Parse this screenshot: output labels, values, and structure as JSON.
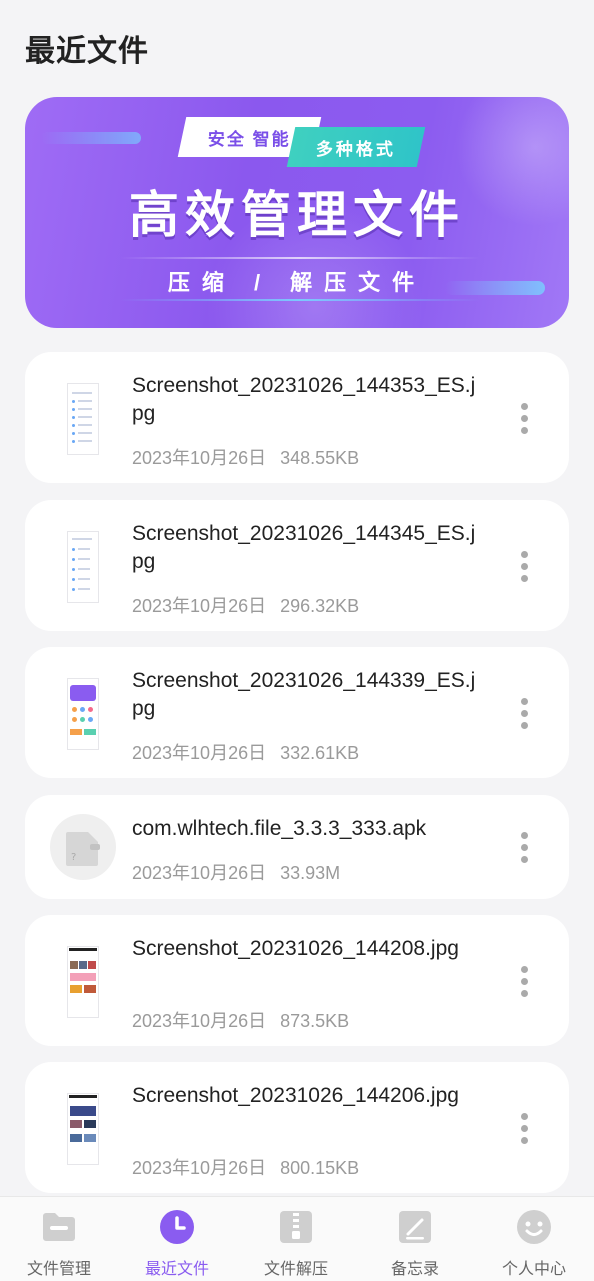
{
  "page": {
    "title": "最近文件"
  },
  "banner": {
    "tag1": "安全 智能",
    "tag2": "多种格式",
    "headline": "高效管理文件",
    "subline": "压缩 / 解压文件"
  },
  "files": [
    {
      "name": "Screenshot_20231026_144353_ES.jpg",
      "date": "2023年10月26日",
      "size": "348.55KB",
      "icon": "screenshot-thumbnail"
    },
    {
      "name": "Screenshot_20231026_144345_ES.jpg",
      "date": "2023年10月26日",
      "size": "296.32KB",
      "icon": "screenshot-thumbnail"
    },
    {
      "name": "Screenshot_20231026_144339_ES.jpg",
      "date": "2023年10月26日",
      "size": "332.61KB",
      "icon": "screenshot-thumbnail"
    },
    {
      "name": "com.wlhtech.file_3.3.3_333.apk",
      "date": "2023年10月26日",
      "size": "33.93M",
      "icon": "unknown-file-icon"
    },
    {
      "name": "Screenshot_20231026_144208.jpg",
      "date": "2023年10月26日",
      "size": "873.5KB",
      "icon": "screenshot-thumbnail"
    },
    {
      "name": "Screenshot_20231026_144206.jpg",
      "date": "2023年10月26日",
      "size": "800.15KB",
      "icon": "screenshot-thumbnail"
    }
  ],
  "nav": [
    {
      "label": "文件管理",
      "icon": "folder-icon"
    },
    {
      "label": "最近文件",
      "icon": "clock-icon",
      "active": true
    },
    {
      "label": "文件解压",
      "icon": "zip-icon"
    },
    {
      "label": "备忘录",
      "icon": "memo-icon"
    },
    {
      "label": "个人中心",
      "icon": "smiley-icon"
    }
  ],
  "colors": {
    "accent": "#8a5cf0",
    "teal": "#2fc4c8",
    "inactive_icon": "#cfcfcf"
  }
}
